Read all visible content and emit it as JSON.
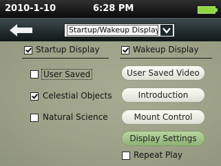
{
  "status_bar": {
    "date": "2010-1-10",
    "time": "6:28 PM",
    "battery_icon": "battery-full-icon"
  },
  "title_bar": {
    "title": "Startup/Wakeup Display",
    "back_icon": "back-arrow-icon",
    "dropdown_icon": "chevron-down-icon"
  },
  "startup": {
    "header": {
      "label": "Startup Display",
      "checked": true
    },
    "options": [
      {
        "label": "User Saved",
        "checked": false,
        "focused": true
      },
      {
        "label": "Celestial Objects",
        "checked": true
      },
      {
        "label": "Natural Science",
        "checked": false
      }
    ]
  },
  "wakeup": {
    "header": {
      "label": "Wakeup Display",
      "checked": true
    },
    "buttons": [
      {
        "label": "User Saved Video",
        "active": false
      },
      {
        "label": "Introduction",
        "active": false
      },
      {
        "label": "Mount Control",
        "active": false
      },
      {
        "label": "Display Settings",
        "active": true
      }
    ],
    "repeat": {
      "label": "Repeat Play",
      "checked": false
    }
  },
  "colors": {
    "panel": "#9da188",
    "active_button": "#a3c38a",
    "battery": "#8fd63f"
  }
}
